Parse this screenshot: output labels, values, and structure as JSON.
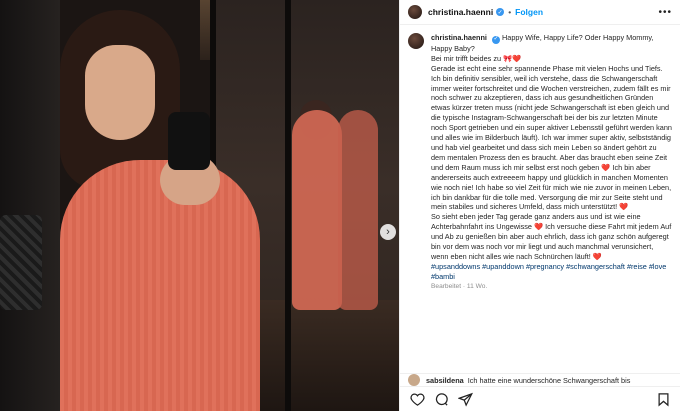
{
  "post": {
    "username": "christina.haenni",
    "follow_label": "Folgen",
    "more_label": "•••",
    "verified_mark": "✓",
    "caption_lines": [
      "Happy Wife, Happy Life? Oder Happy Mommy, Happy Baby?",
      "Bei mir trifft beides zu 🎀❤️",
      "Gerade ist echt eine sehr spannende Phase mit vielen Hochs und Tiefs. Ich bin definitiv sensibler, weil ich verstehe, dass die Schwangerschaft immer weiter fortschreitet und die Wochen verstreichen, zudem fällt es mir noch schwer zu akzeptieren, dass ich aus gesundheitlichen Gründen etwas kürzer treten muss (nicht jede Schwangerschaft ist eben gleich und die typische Instagram-Schwangerschaft bei der bis zur letzten Minute noch Sport getrieben und ein super aktiver Lebensstil geführt werden kann und alles wie im Bilderbuch läuft). Ich war immer super aktiv, selbstständig und hab viel gearbeitet und dass sich mein Leben so ändert gehört zu dem mentalen Prozess den es braucht. Aber das braucht eben seine Zeit und dem Raum muss ich mir selbst erst noch geben ❤️ Ich bin aber andererseits auch extreeeem happy und glücklich in manchen Momenten wie noch nie! Ich habe so viel Zeit für mich wie nie zuvor in meinen Leben, ich bin dankbar für die tolle med. Versorgung die mir zur Seite steht und mein stabiles und sicheres Umfeld, dass mich unterstützt! ❤️",
      "So sieht eben jeder Tag gerade ganz anders aus und ist wie eine Achterbahnfahrt ins Ungewisse ❤️ Ich versuche diese Fahrt mit jedem Auf und Ab zu genießen bin aber auch ehrlich, dass ich ganz schön aufgeregt bin vor dem was noch vor mir liegt und auch manchmal verunsichert, wenn eben nicht alles wie nach Schnürchen läuft! ❤️"
    ],
    "hashtags": "#upsanddowns #upanddown #pregnancy #schwangerschaft #reise #love #bambi",
    "edited_label": "Bearbeitet · 11 Wo.",
    "comment": {
      "username": "sabsildena",
      "text": "Ich hatte eine wunderschöne Schwangerschaft bis"
    },
    "next_arrow": "›"
  },
  "icons": [
    "heart-icon",
    "comment-icon",
    "share-icon",
    "save-icon"
  ],
  "colors": {
    "accent": "#0095f6",
    "hashtag": "#00376b",
    "muted": "#8e8e8e"
  }
}
